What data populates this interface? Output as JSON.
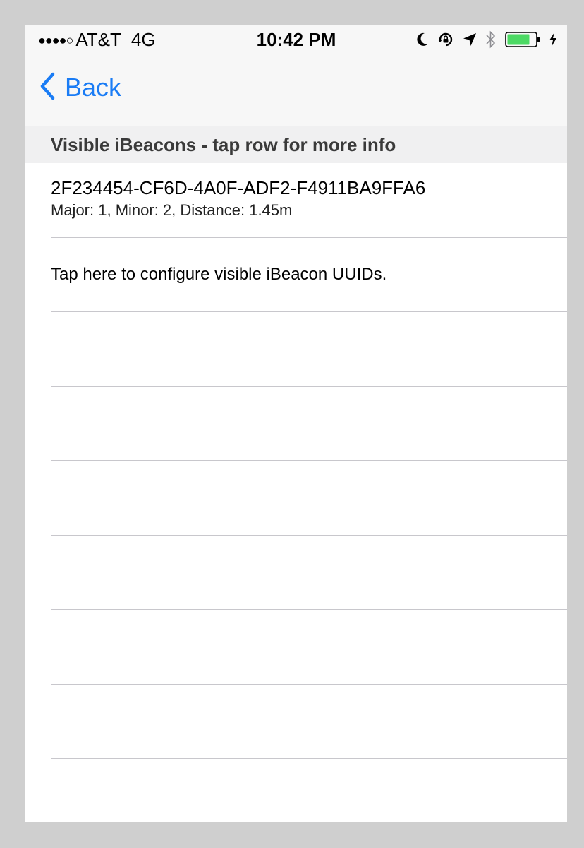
{
  "status_bar": {
    "signal": "●●●●○",
    "carrier": "AT&T",
    "network": "4G",
    "time": "10:42 PM",
    "icons": [
      "moon-icon",
      "rotation-lock-icon",
      "location-arrow-icon",
      "bluetooth-icon",
      "battery-icon",
      "charging-bolt-icon"
    ],
    "battery_level_percent": 80,
    "battery_color": "#4cd964"
  },
  "nav": {
    "back_label": "Back",
    "tint_color": "#1a7cf5"
  },
  "section": {
    "header": "Visible iBeacons - tap row for more info"
  },
  "beacons": [
    {
      "uuid": "2F234454-CF6D-4A0F-ADF2-F4911BA9FFA6",
      "details": "Major: 1, Minor: 2, Distance: 1.45m"
    }
  ],
  "configure_row": {
    "label": "Tap here to configure visible iBeacon UUIDs."
  }
}
